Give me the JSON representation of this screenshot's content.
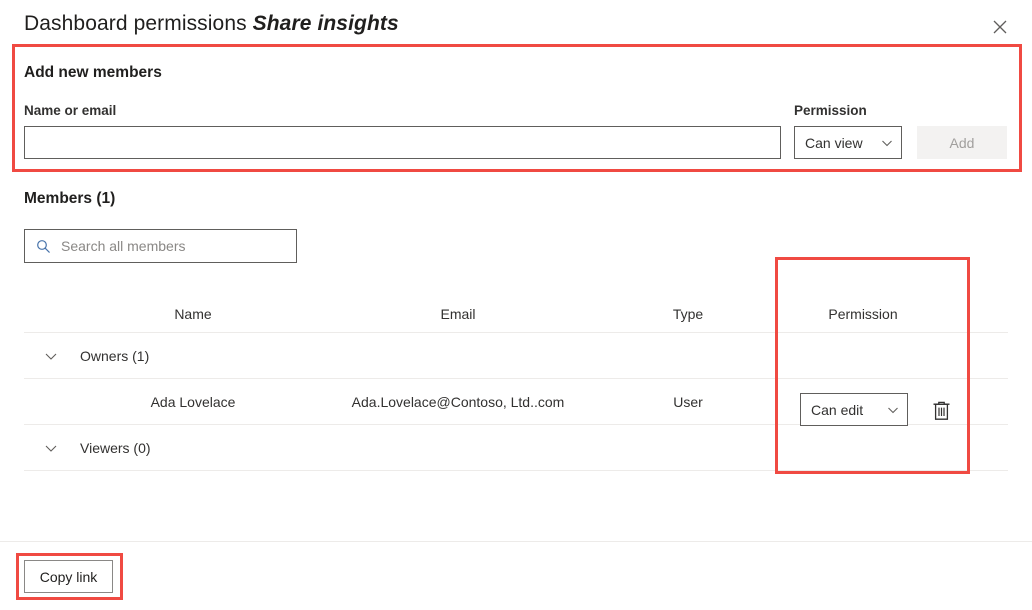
{
  "dialog": {
    "title_main": "Dashboard permissions",
    "title_emphasis": "Share insights",
    "close_icon": "close-icon"
  },
  "add_members": {
    "section_title": "Add new members",
    "name_label": "Name or email",
    "name_value": "",
    "name_placeholder": "",
    "permission_label": "Permission",
    "permission_value": "Can view",
    "add_button": "Add",
    "add_button_disabled": true,
    "chevron_icon": "chevron-down-icon"
  },
  "members": {
    "section_title": "Members (1)",
    "search_placeholder": "Search all members",
    "search_value": "",
    "search_icon": "search-icon",
    "columns": {
      "name": "Name",
      "email": "Email",
      "type": "Type",
      "permission": "Permission"
    },
    "groups": [
      {
        "label": "Owners (1)",
        "expanded": true,
        "chevron_icon": "chevron-down-icon",
        "rows": [
          {
            "name": "Ada Lovelace",
            "email": "Ada.Lovelace@Contoso, Ltd..com",
            "type": "User",
            "permission": "Can edit",
            "delete_icon": "trash-icon"
          }
        ]
      },
      {
        "label": "Viewers (0)",
        "expanded": true,
        "chevron_icon": "chevron-down-icon",
        "rows": []
      }
    ]
  },
  "footer": {
    "copy_link": "Copy link"
  },
  "colors": {
    "annotation": "#f04a42",
    "search_icon": "#4773aa",
    "text": "#323130",
    "border": "#605e5c",
    "disabled_bg": "#f3f2f1",
    "disabled_text": "#a19f9d",
    "divider": "#edebe9"
  }
}
